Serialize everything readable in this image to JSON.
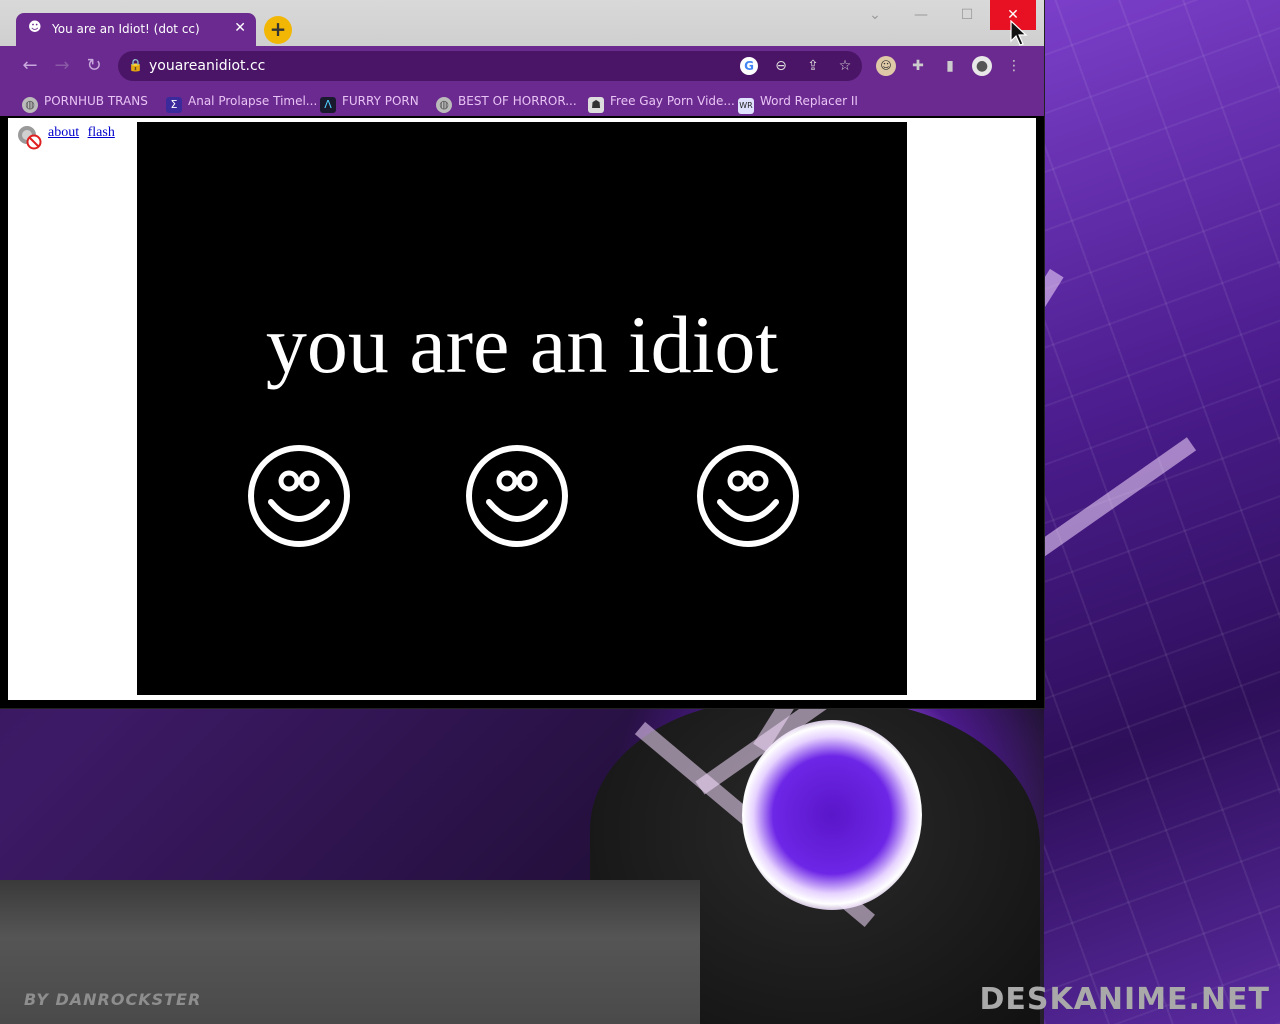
{
  "browser": {
    "tab_title": "You are an Idiot! (dot cc)",
    "tab_close": "✕",
    "new_tab": "+",
    "url": "youareanidiot.cc",
    "window_controls": {
      "minimize": "—",
      "maximize": "☐",
      "close": "✕"
    },
    "nav": {
      "back": "←",
      "forward": "→",
      "reload": "↻"
    },
    "omnibox_icons": [
      "google-icon",
      "zoom-out-icon",
      "share-icon",
      "star-icon"
    ],
    "bookmarks": [
      {
        "label": "PORNHUB TRANS",
        "icon": "globe-icon"
      },
      {
        "label": "Anal Prolapse Timel...",
        "icon": "sigma-icon"
      },
      {
        "label": "FURRY PORN",
        "icon": "lambda-icon"
      },
      {
        "label": "BEST OF HORROR...",
        "icon": "globe-icon"
      },
      {
        "label": "Free Gay Porn Vide...",
        "icon": "site-icon"
      },
      {
        "label": "Word Replacer II",
        "icon": "wr-icon"
      }
    ]
  },
  "page": {
    "links": [
      "about",
      "flash"
    ],
    "headline": "you are an idiot",
    "smiley_count": 3
  },
  "desktop": {
    "watermark_left": "BY DANROCKSTER",
    "watermark_right": "DESKANIME.NET"
  },
  "colors": {
    "chrome_purple": "#6b2a8f",
    "omnibox": "#4a1566",
    "close_red": "#e81123",
    "bookmark_text": "#e8c3f5"
  }
}
